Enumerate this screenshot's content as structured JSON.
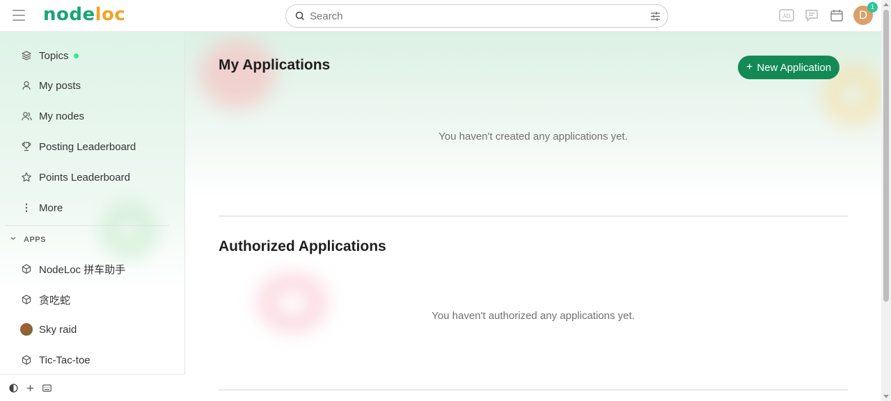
{
  "header": {
    "logo_part1": "node",
    "logo_part2": "loc",
    "search_placeholder": "Search",
    "notification_count": "1",
    "avatar_letter": "D"
  },
  "sidebar": {
    "nav": [
      {
        "label": "Topics",
        "icon": "layers-icon"
      },
      {
        "label": "My posts",
        "icon": "user-icon"
      },
      {
        "label": "My nodes",
        "icon": "users-icon"
      },
      {
        "label": "Posting Leaderboard",
        "icon": "trophy-icon"
      },
      {
        "label": "Points Leaderboard",
        "icon": "star-icon"
      },
      {
        "label": "More",
        "icon": "more-vertical-icon"
      }
    ],
    "apps_heading": "APPS",
    "apps": [
      {
        "label": "NodeLoc 拼车助手",
        "icon": "cube-icon"
      },
      {
        "label": "贪吃蛇",
        "icon": "cube-icon"
      },
      {
        "label": "Sky raid",
        "icon": "app-avatar"
      },
      {
        "label": "Tic-Tac-toe",
        "icon": "cube-icon"
      }
    ]
  },
  "main": {
    "my_apps_title": "My Applications",
    "new_app_button": "New Application",
    "my_apps_empty": "You haven't created any applications yet.",
    "authorized_title": "Authorized Applications",
    "authorized_empty": "You haven't authorized any applications yet."
  },
  "colors": {
    "brand_green": "#16a673",
    "brand_orange": "#f0a424",
    "button_green": "#138a56",
    "online_dot": "#2ee896"
  }
}
